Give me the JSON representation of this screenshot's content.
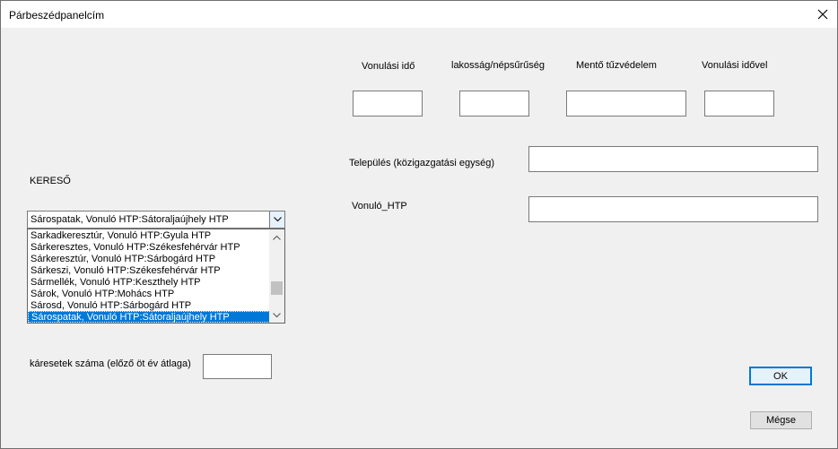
{
  "window": {
    "title": "Párbeszédpanelcím"
  },
  "labels": {
    "vonulasi_ido": "Vonulási idő",
    "lakossag": "lakosság/népsűrűség",
    "mento": "Mentő tűzvédelem",
    "vonulasi_idovel": "Vonulási idővel",
    "telepules": "Település (közigazgatási egység)",
    "vonulo_htp": "Vonuló_HTP",
    "kereso": "KERESŐ",
    "karesetek": "káresetek száma (előző öt év átlaga)"
  },
  "fields": {
    "vonulasi_ido": "",
    "lakossag": "",
    "mento": "",
    "vonulasi_idovel": "",
    "telepules": "",
    "vonulo_htp": "",
    "karesetek": ""
  },
  "search": {
    "value": "Sárospatak, Vonuló HTP:Sátoraljaújhely HTP",
    "items": [
      "Sarkadkeresztúr, Vonuló HTP:Gyula HTP",
      "Sárkeresztes, Vonuló HTP:Székesfehérvár HTP",
      "Sárkeresztúr, Vonuló HTP:Sárbogárd HTP",
      "Sárkeszi, Vonuló HTP:Székesfehérvár HTP",
      "Sármellék, Vonuló HTP:Keszthely HTP",
      "Sárok, Vonuló HTP:Mohács HTP",
      "Sárosd, Vonuló HTP:Sárbogárd HTP",
      "Sárospatak, Vonuló HTP:Sátoraljaújhely HTP"
    ],
    "selected_index": 7
  },
  "buttons": {
    "ok": "OK",
    "cancel": "Mégse"
  },
  "icons": {
    "close": "close-icon",
    "dropdown": "chevron-down-icon",
    "scroll_up": "chevron-up-icon",
    "scroll_down": "chevron-down-icon"
  },
  "colors": {
    "selection": "#0078d7",
    "default_button_border": "#0078d7"
  }
}
